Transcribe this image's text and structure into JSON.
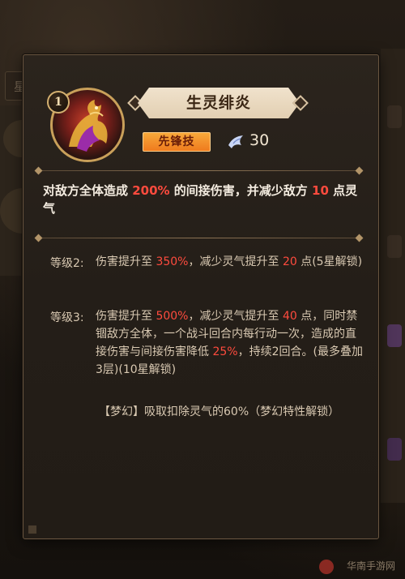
{
  "background": {
    "tab_label": "星级技能"
  },
  "skill": {
    "level": "1",
    "name": "生灵绯炎",
    "tag": "先锋技",
    "energy": "30"
  },
  "description": {
    "p1": "对敌方全体造成 ",
    "v1": "200%",
    "p2": " 的间接伤害，并减少敌方 ",
    "v2": "10",
    "p3": " 点灵气"
  },
  "level2": {
    "label": "等级2:",
    "p1": "伤害提升至 ",
    "v1": "350%",
    "p2": "，减少灵气提升至 ",
    "v2": "20",
    "p3": " 点(5星解锁)"
  },
  "level3": {
    "label": "等级3:",
    "p1": "伤害提升至 ",
    "v1": "500%",
    "p2": "，减少灵气提升至 ",
    "v2": "40",
    "p3": " 点，同时禁锢敌方全体，一个战斗回合内每行动一次，造成的直接伤害与间接伤害降低 ",
    "v3": "25%",
    "p4": "，持续2回合。(最多叠加3层)(10星解锁)"
  },
  "dream": {
    "text": "【梦幻】吸取扣除灵气的60%（梦幻特性解锁）"
  },
  "watermark": {
    "text": "华南手游网"
  },
  "colors": {
    "highlight": "#ff4b3e",
    "tag_orange": "#ef7b1e",
    "frame_gold": "#c9a05a"
  }
}
